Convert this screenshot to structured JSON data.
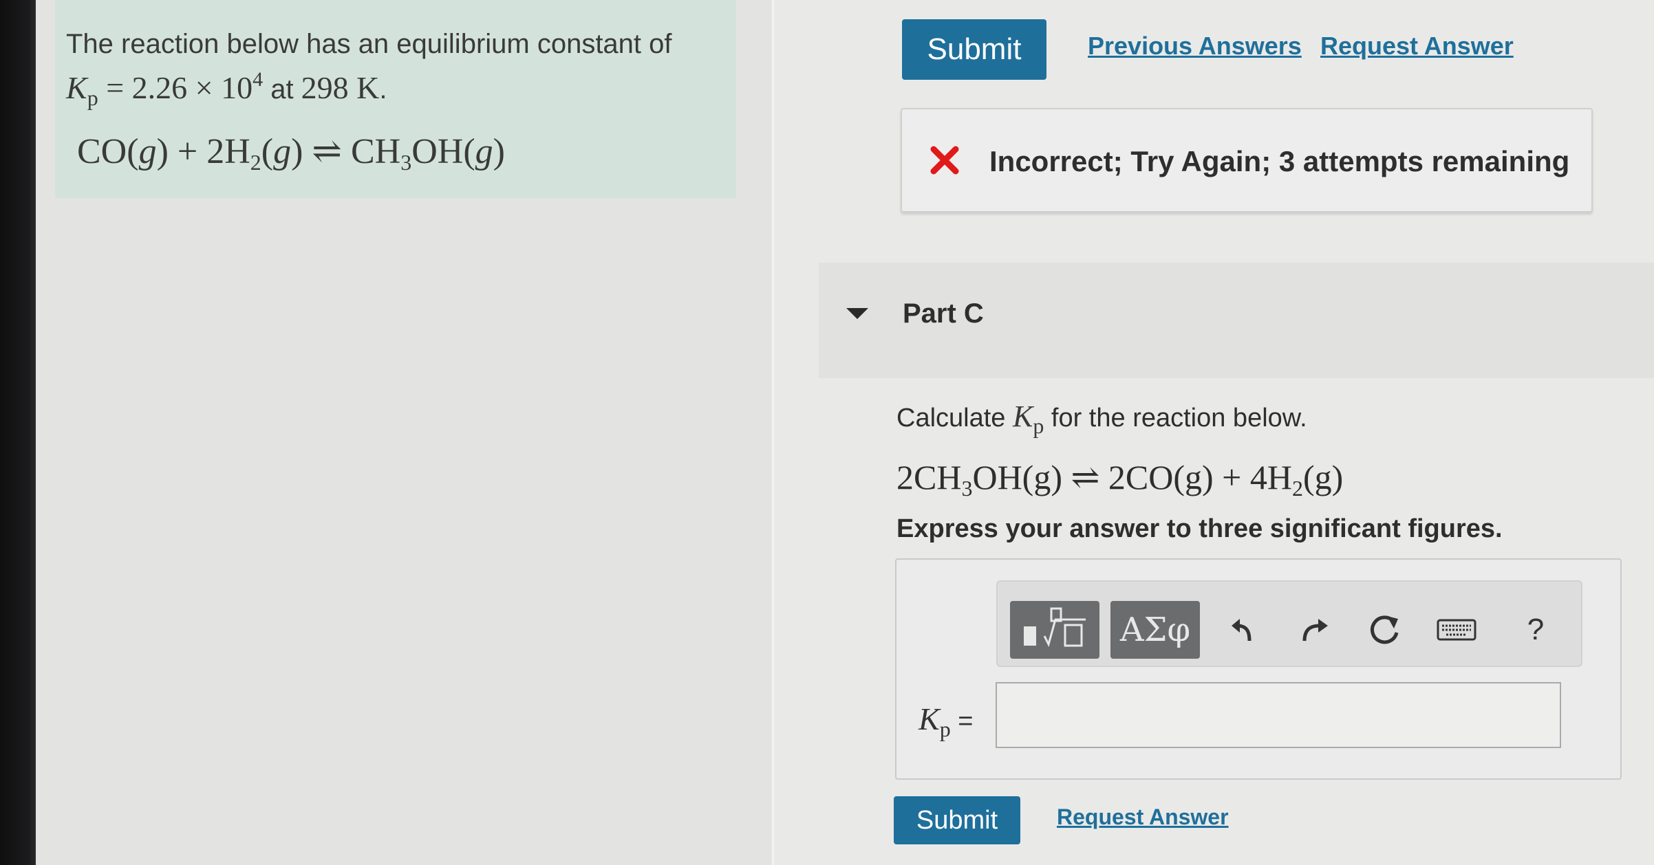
{
  "intro": {
    "line1": "The reaction below has an equilibrium constant of",
    "kp_symbol": "K",
    "kp_sub": "p",
    "kp_value_eq": "= 2.26 × 10",
    "kp_exponent": "4",
    "at_text": " at ",
    "temperature": "298 K",
    "period": ".",
    "reaction": {
      "r1": "CO(",
      "r1_state": "g",
      "r1_close": ") + 2H",
      "r2_sub": "2",
      "r2_open": "(",
      "r2_state": "g",
      "r2_close": ") ",
      "arrow": "⇌",
      "p1": " CH",
      "p1_sub": "3",
      "p1_rest": "OH(",
      "p1_state": "g",
      "p1_close": ")"
    }
  },
  "toolbar_top": {
    "submit_label": "Submit",
    "previous_answers_label": "Previous Answers",
    "request_answer_label": "Request Answer"
  },
  "feedback": {
    "message": "Incorrect; Try Again; 3 attempts remaining",
    "status_color": "#e01919"
  },
  "part": {
    "title": "Part C",
    "question_prefix": "Calculate ",
    "question_kp": "K",
    "question_kp_sub": "p",
    "question_suffix": " for the reaction below.",
    "reaction": {
      "a": "2CH",
      "a_sub": "3",
      "b": "OH(g) ",
      "arrow": "⇌",
      "c": " 2CO(g) + 4H",
      "c_sub": "2",
      "d": "(g)"
    },
    "instructions": "Express your answer to three significant figures.",
    "answer_label_symbol": "K",
    "answer_label_sub": "p",
    "answer_label_eq": " =",
    "answer_value": "",
    "tools": {
      "templates_icon": "templates-icon",
      "symbols_label": "ΑΣφ",
      "undo_icon": "undo-icon",
      "redo_icon": "redo-icon",
      "reset_icon": "reset-icon",
      "keyboard_icon": "keyboard-icon",
      "help_label": "?"
    },
    "submit_label": "Submit",
    "request_answer_label": "Request Answer"
  },
  "colors": {
    "accent": "#1f6f9b",
    "intro_bg": "#d3e3dc",
    "error": "#e01919"
  }
}
